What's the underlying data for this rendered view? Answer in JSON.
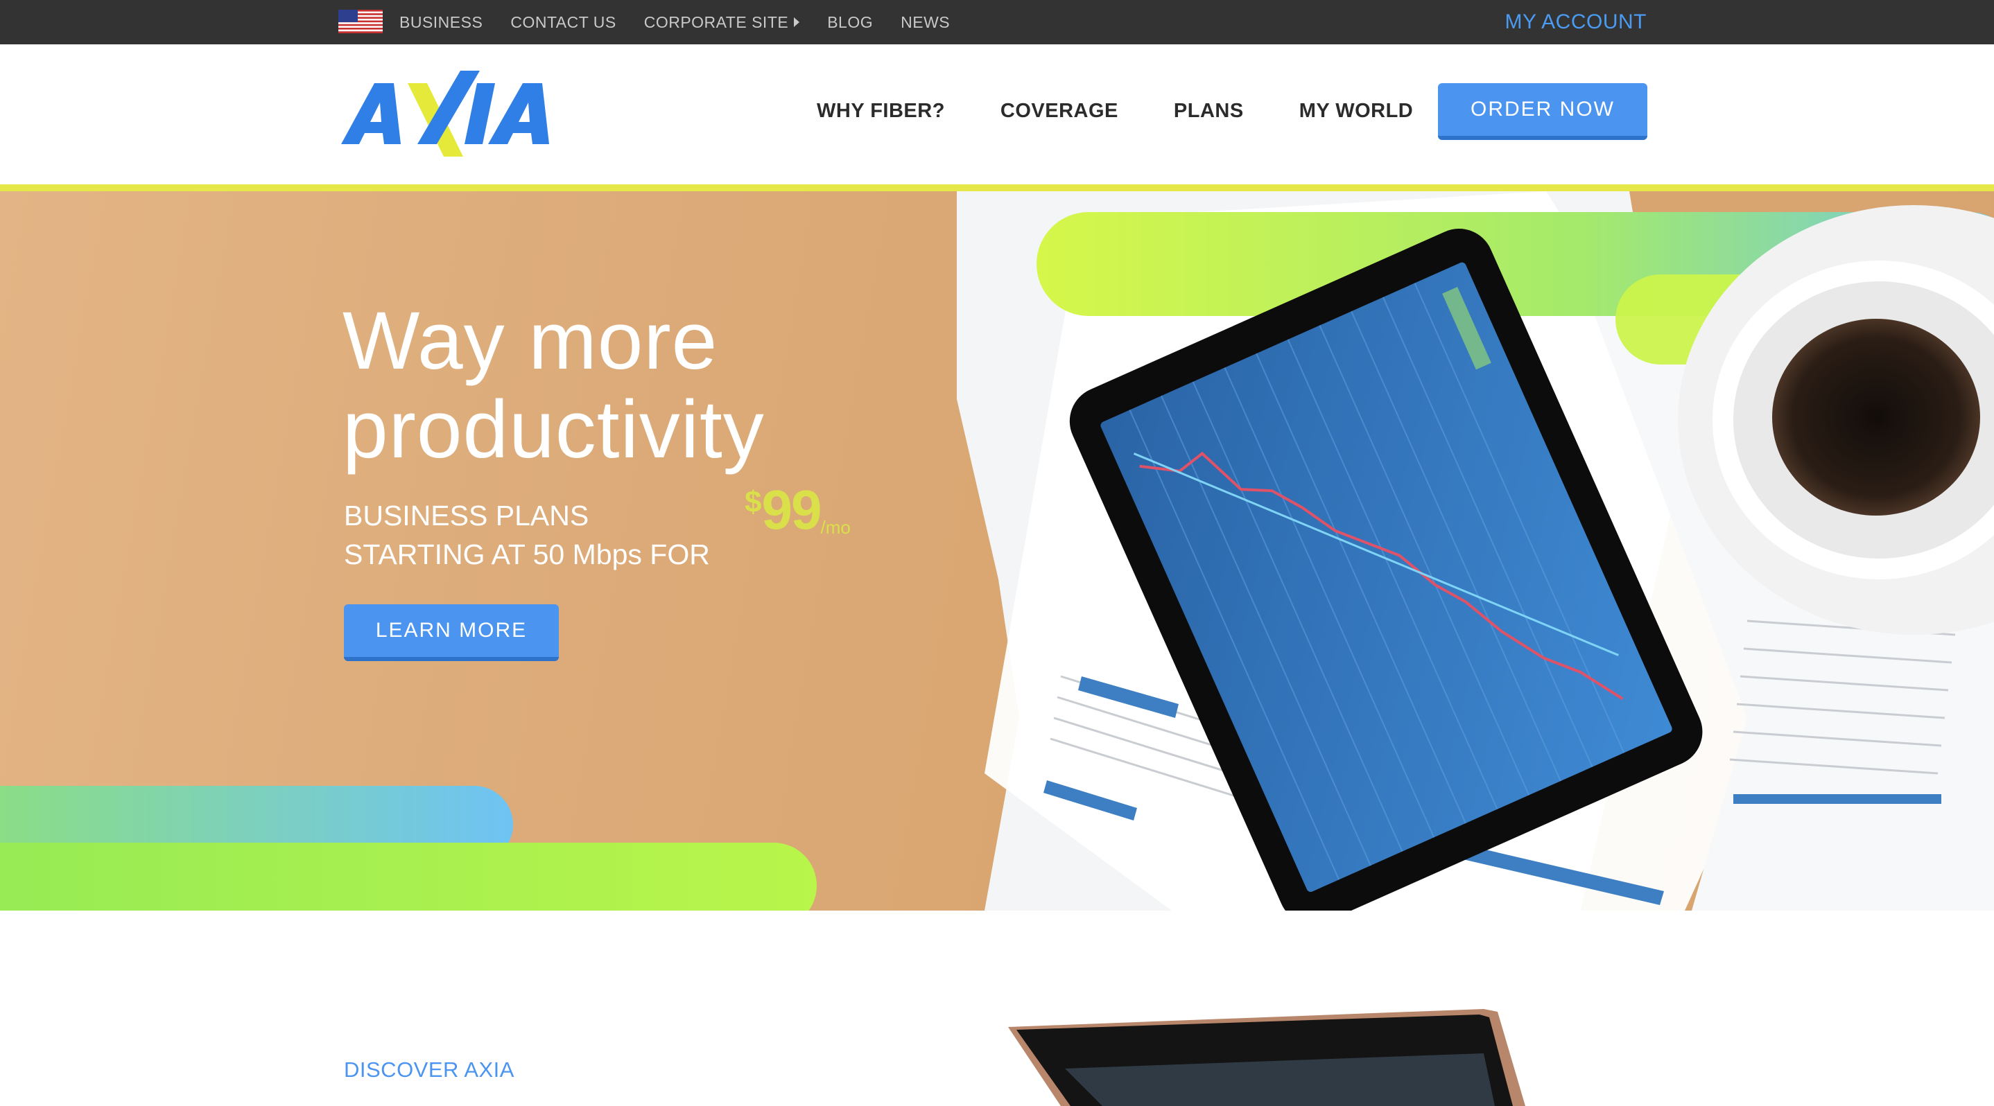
{
  "topbar": {
    "flag_icon": "us-flag-icon",
    "links": [
      {
        "label": "BUSINESS"
      },
      {
        "label": "CONTACT US"
      },
      {
        "label": "CORPORATE SITE",
        "has_caret": true
      },
      {
        "label": "BLOG"
      },
      {
        "label": "NEWS"
      }
    ],
    "my_account": "MY ACCOUNT"
  },
  "header": {
    "logo_text": "AXIA",
    "nav": [
      "WHY FIBER?",
      "COVERAGE",
      "PLANS",
      "MY WORLD"
    ],
    "order_button": "ORDER NOW"
  },
  "hero": {
    "title_line1": "Way more",
    "title_line2": "productivity",
    "subtitle_line1": "BUSINESS PLANS",
    "subtitle_line2": "STARTING AT 50 Mbps FOR",
    "price_currency": "$",
    "price_amount": "99",
    "price_period": "/mo",
    "cta": "LEARN MORE"
  },
  "section": {
    "heading": "DISCOVER AXIA"
  },
  "colors": {
    "topbar_bg": "#333333",
    "accent_blue": "#4b94ef",
    "accent_yellow": "#e6e84a",
    "lime": "#b8f24a"
  }
}
